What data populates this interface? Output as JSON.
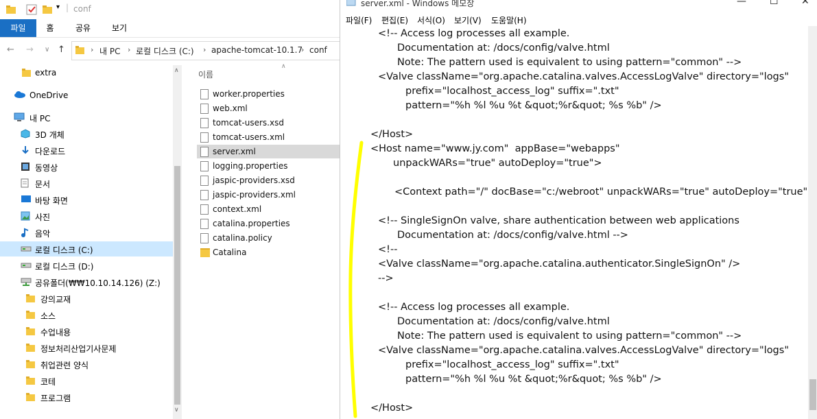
{
  "explorer": {
    "title": "conf",
    "ribbon_tabs": [
      "파일",
      "홈",
      "공유",
      "보기"
    ],
    "address": [
      "내 PC",
      "로컬 디스크 (C:)",
      "apache-tomcat-10.1.7",
      "conf"
    ],
    "column_header": "이름",
    "nav_items": [
      {
        "label": "extra",
        "icon": "folder-icon"
      },
      {
        "label": "OneDrive",
        "icon": "cloud-icon"
      },
      {
        "label": "내 PC",
        "icon": "computer-icon"
      },
      {
        "label": "3D 개체",
        "icon": "cube-icon"
      },
      {
        "label": "다운로드",
        "icon": "download-icon"
      },
      {
        "label": "동영상",
        "icon": "film-icon"
      },
      {
        "label": "문서",
        "icon": "document-icon"
      },
      {
        "label": "바탕 화면",
        "icon": "desktop-icon"
      },
      {
        "label": "사진",
        "icon": "picture-icon"
      },
      {
        "label": "음악",
        "icon": "music-icon"
      },
      {
        "label": "로컬 디스크 (C:)",
        "icon": "drive-icon"
      },
      {
        "label": "로컬 디스크 (D:)",
        "icon": "drive-icon"
      },
      {
        "label": "공유폴더(₩₩10.10.14.126) (Z:)",
        "icon": "network-drive-icon"
      },
      {
        "label": "강의교재",
        "icon": "folder-icon"
      },
      {
        "label": "소스",
        "icon": "folder-icon"
      },
      {
        "label": "수업내용",
        "icon": "folder-icon"
      },
      {
        "label": "정보처리산업기사문제",
        "icon": "folder-icon"
      },
      {
        "label": "취업관련 양식",
        "icon": "folder-icon"
      },
      {
        "label": "코테",
        "icon": "folder-icon"
      },
      {
        "label": "프로그램",
        "icon": "folder-icon"
      }
    ],
    "files": [
      {
        "name": "worker.properties",
        "type": "file"
      },
      {
        "name": "web.xml",
        "type": "file"
      },
      {
        "name": "tomcat-users.xsd",
        "type": "file"
      },
      {
        "name": "tomcat-users.xml",
        "type": "file"
      },
      {
        "name": "server.xml",
        "type": "file"
      },
      {
        "name": "logging.properties",
        "type": "file"
      },
      {
        "name": "jaspic-providers.xsd",
        "type": "file"
      },
      {
        "name": "jaspic-providers.xml",
        "type": "file"
      },
      {
        "name": "context.xml",
        "type": "file"
      },
      {
        "name": "catalina.properties",
        "type": "file"
      },
      {
        "name": "catalina.policy",
        "type": "file"
      },
      {
        "name": "Catalina",
        "type": "folder"
      }
    ],
    "selected_file": "server.xml",
    "selected_nav": "로컬 디스크 (C:)"
  },
  "notepad": {
    "title": "server.xml - Windows 메모장",
    "menu": [
      "파일(F)",
      "편집(E)",
      "서식(O)",
      "보기(V)",
      "도움말(H)"
    ],
    "lines": [
      "<!-- Access log processes all example.",
      "Documentation at: /docs/config/valve.html",
      "Note: The pattern used is equivalent to using pattern=\"common\" -->",
      "<Valve className=\"org.apache.catalina.valves.AccessLogValve\" directory=\"logs\"",
      "prefix=\"localhost_access_log\" suffix=\".txt\"",
      "pattern=\"%h %l %u %t &quot;%r&quot; %s %b\" />",
      "",
      "</Host>",
      "<Host name=\"www.jy.com\"  appBase=\"webapps\"",
      "unpackWARs=\"true\" autoDeploy=\"true\">",
      "",
      "<Context path=\"/\" docBase=\"c:/webroot\" unpackWARs=\"true\" autoDeploy=\"true\"",
      "",
      "<!-- SingleSignOn valve, share authentication between web applications",
      "Documentation at: /docs/config/valve.html -->",
      "<!--",
      "<Valve className=\"org.apache.catalina.authenticator.SingleSignOn\" />",
      "-->",
      "",
      "<!-- Access log processes all example.",
      "Documentation at: /docs/config/valve.html",
      "Note: The pattern used is equivalent to using pattern=\"common\" -->",
      "<Valve className=\"org.apache.catalina.valves.AccessLogValve\" directory=\"logs\"",
      "prefix=\"localhost_access_log\" suffix=\".txt\"",
      "pattern=\"%h %l %u %t &quot;%r&quot; %s %b\" />",
      "",
      "</Host>"
    ]
  },
  "colors": {
    "accent": "#1a6fc4",
    "highlight": "#ffff00",
    "selection": "#cce8ff"
  }
}
